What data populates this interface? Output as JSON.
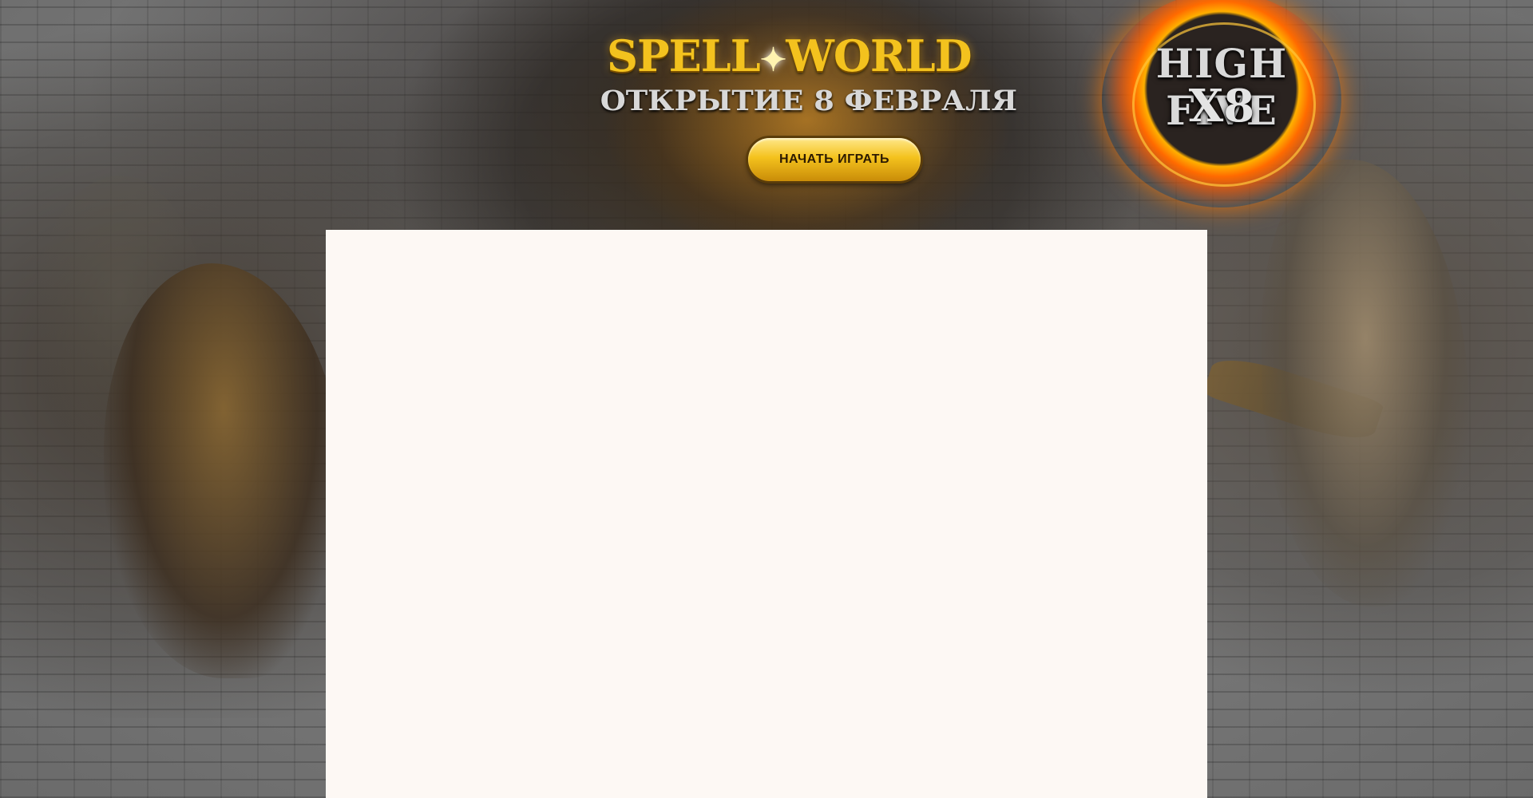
{
  "banner": {
    "logo_left": "SPELL",
    "logo_right": "WORLD",
    "opening_text": "ОТКРЫТИЕ 8 ФЕВРАЛЯ",
    "play_button_label": "НАЧАТЬ ИГРАТЬ"
  },
  "badge": {
    "title": "HIGH FIVE",
    "rate": "X8"
  }
}
